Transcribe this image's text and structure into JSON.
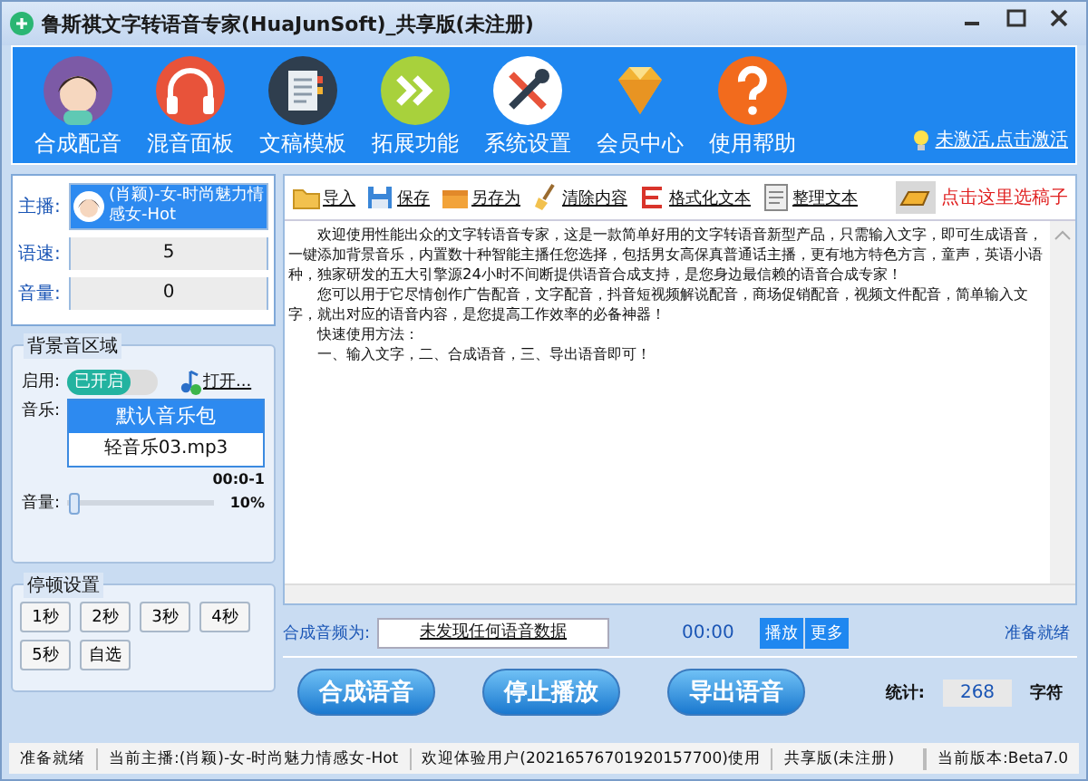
{
  "window": {
    "title": "鲁斯祺文字转语音专家(HuaJunSoft)_共享版(未注册)"
  },
  "toolbar": {
    "items": [
      {
        "label": "合成配音",
        "kind": "avatar"
      },
      {
        "label": "混音面板",
        "kind": "headphones"
      },
      {
        "label": "文稿模板",
        "kind": "notebook"
      },
      {
        "label": "拓展功能",
        "kind": "chevrons"
      },
      {
        "label": "系统设置",
        "kind": "tools"
      },
      {
        "label": "会员中心",
        "kind": "diamond"
      },
      {
        "label": "使用帮助",
        "kind": "help"
      }
    ],
    "activation": "未激活,点击激活"
  },
  "voice_panel": {
    "anchor_label": "主播:",
    "anchor_value": "(肖颖)-女-时尚魅力情感女-Hot",
    "speed_label": "语速:",
    "speed_value": "5",
    "volume_label": "音量:",
    "volume_value": "0"
  },
  "background_music": {
    "title": "背景音区域",
    "enable_label": "启用:",
    "toggle": {
      "label": "已开启",
      "on": true
    },
    "open_button": "打开...",
    "music_label": "音乐:",
    "music_items": [
      {
        "label": "默认音乐包",
        "selected": true
      },
      {
        "label": "轻音乐03.mp3",
        "selected": false
      }
    ],
    "time": "00:0-1",
    "volume_label": "音量:",
    "volume": {
      "level": 0.05,
      "reading": "10%"
    }
  },
  "pause_settings": {
    "title": "停顿设置",
    "buttons": [
      "1秒",
      "2秒",
      "3秒",
      "4秒",
      "5秒",
      "自选"
    ]
  },
  "editor": {
    "tools": [
      {
        "label": "导入",
        "kind": "folder"
      },
      {
        "label": "保存",
        "kind": "disk"
      },
      {
        "label": "另存为",
        "kind": "box"
      },
      {
        "label": "清除内容",
        "kind": "broom"
      },
      {
        "label": "格式化文本",
        "kind": "format"
      },
      {
        "label": "整理文本",
        "kind": "doc"
      }
    ],
    "template_link": "点击这里选稿子",
    "paragraphs": [
      "　　欢迎使用性能出众的文字转语音专家，这是一款简单好用的文字转语音新型产品，只需输入文字，即可生成语音，一键添加背景音乐，内置数十种智能主播任您选择，包括男女高保真普通话主播，更有地方特色方言，童声，英语小语种，独家研发的五大引擎源24小时不间断提供语音合成支持，是您身边最信赖的语音合成专家！",
      "　　您可以用于它尽情创作广告配音，文字配音，抖音短视频解说配音，商场促销配音，视频文件配音，简单输入文字，就出对应的语音内容，是您提高工作效率的必备神器！",
      "　　快速使用方法：",
      "　　一、输入文字，二、合成语音，三、导出语音即可！"
    ]
  },
  "output": {
    "label": "合成音频为:",
    "value": "未发现任何语音数据",
    "time": "00:00",
    "play_button": "播放",
    "more_button": "更多",
    "status": "准备就绪"
  },
  "actions": [
    "合成语音",
    "停止播放",
    "导出语音"
  ],
  "stats": {
    "label": "统计:",
    "value": "268",
    "unit": "字符"
  },
  "status_bar": [
    "准备就绪",
    "当前主播:(肖颖)-女-时尚魅力情感女-Hot",
    "欢迎体验用户(20216576701920157700)使用",
    "共享版(未注册)",
    "当前版本:Beta7.0"
  ]
}
